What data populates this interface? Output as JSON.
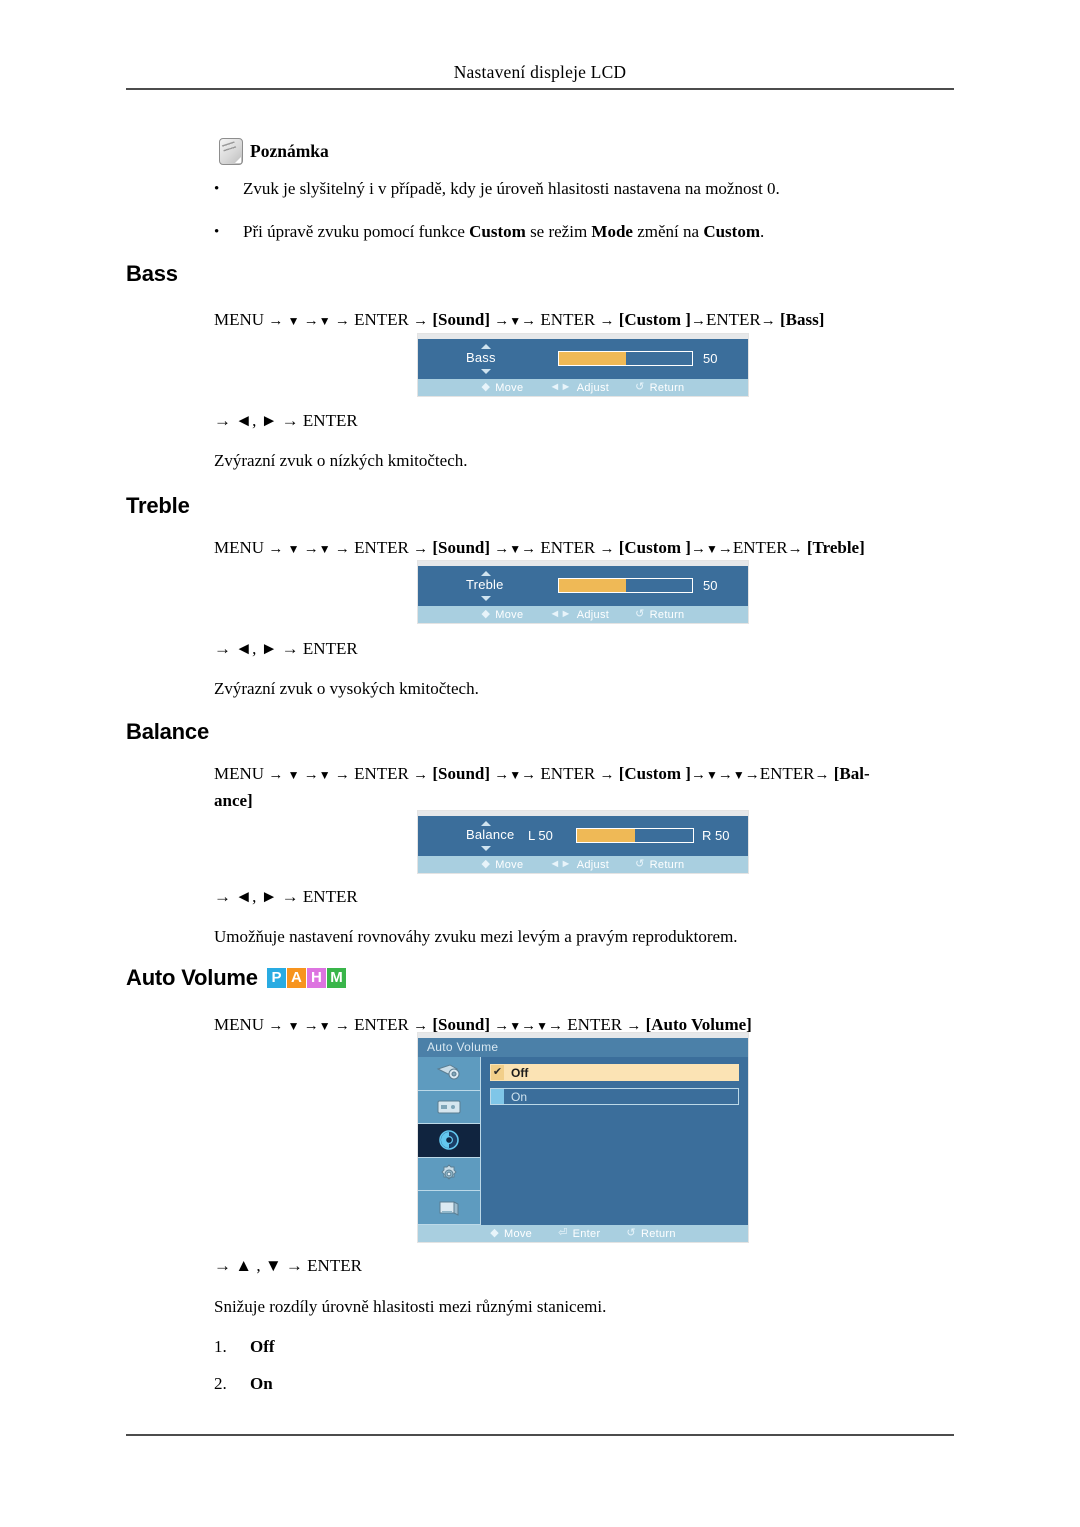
{
  "header": {
    "title": "Nastavení displeje LCD"
  },
  "note": {
    "icon": "note-pen-icon",
    "label": "Poznámka",
    "bullet_marker": "•",
    "items": [
      {
        "prefix": "Zvuk je slyšitelný i v případě, kdy je úroveň hlasitosti nastavena na možnost 0.",
        "bold1": "",
        "mid": "",
        "bold2": "",
        "mid2": "",
        "bold3": "",
        "suffix": ""
      },
      {
        "prefix": "Při úpravě zvuku pomocí funkce ",
        "bold1": "Custom",
        "mid": " se režim ",
        "bold2": "Mode",
        "mid2": " změní na ",
        "bold3": "Custom",
        "suffix": "."
      }
    ]
  },
  "sections": {
    "bass": {
      "heading": "Bass",
      "path": {
        "menu": "MENU",
        "a1": "→",
        "d1": "▼",
        "a2": "→",
        "d2": "▼",
        "a3": "→",
        "enter1": "ENTER",
        "a4": "→",
        "sound": "[Sound]",
        "a5": "→",
        "d3": "▼",
        "a6": "→",
        "enter2": "ENTER",
        "a7": "→",
        "custom": "[Custom ]",
        "a8": "→",
        "enter3": "ENTER",
        "a9": "→",
        "target": "[Bass]"
      },
      "keyline": "→ ◄, ► → ENTER",
      "description": "Zvýrazní zvuk o nízkých kmitočtech.",
      "osd": {
        "label": "Bass",
        "value": "50",
        "fill_percent": 50,
        "footer": [
          {
            "glyph": "◆",
            "text": "Move"
          },
          {
            "glyph": "◄►",
            "text": "Adjust"
          },
          {
            "glyph": "↺",
            "text": "Return"
          }
        ]
      }
    },
    "treble": {
      "heading": "Treble",
      "path": {
        "menu": "MENU",
        "a1": "→",
        "d1": "▼",
        "a2": "→",
        "d2": "▼",
        "a3": "→",
        "enter1": "ENTER",
        "a4": "→",
        "sound": "[Sound]",
        "a5": "→",
        "d3": "▼",
        "a6": "→",
        "enter2": "ENTER",
        "a7": "→",
        "custom": "[Custom ]",
        "a8": "→",
        "d4": "▼",
        "a8b": "→",
        "enter3": "ENTER",
        "a9": "→",
        "target": "[Treble]"
      },
      "keyline": "→ ◄, ► → ENTER",
      "description": "Zvýrazní zvuk o vysokých kmitočtech.",
      "osd": {
        "label": "Treble",
        "value": "50",
        "fill_percent": 50,
        "footer": [
          {
            "glyph": "◆",
            "text": "Move"
          },
          {
            "glyph": "◄►",
            "text": "Adjust"
          },
          {
            "glyph": "↺",
            "text": "Return"
          }
        ]
      }
    },
    "balance": {
      "heading": "Balance",
      "path": {
        "menu": "MENU",
        "a1": "→",
        "d1": "▼",
        "a2": "→",
        "d2": "▼",
        "a3": "→",
        "enter1": "ENTER",
        "a4": "→",
        "sound": "[Sound]",
        "a5": "→",
        "d3": "▼",
        "a6": "→",
        "enter2": "ENTER",
        "a7": "→",
        "custom": "[Custom ]",
        "a8": "→",
        "d4": "▼",
        "a8b": "→",
        "d5": "▼",
        "a8c": "→",
        "enter3": "ENTER",
        "a9": "→",
        "target": "[Bal-",
        "target_wrap": "ance]"
      },
      "keyline": "→ ◄, ► → ENTER",
      "description": "Umožňuje nastavení rovnováhy zvuku mezi levým a pravým reproduktorem.",
      "osd": {
        "label": "Balance",
        "left_label": "L  50",
        "right_label": "R  50",
        "fill_percent": 50,
        "footer": [
          {
            "glyph": "◆",
            "text": "Move"
          },
          {
            "glyph": "◄►",
            "text": "Adjust"
          },
          {
            "glyph": "↺",
            "text": "Return"
          }
        ]
      }
    },
    "auto_volume": {
      "heading": "Auto Volume",
      "badges": [
        {
          "letter": "P",
          "color": "#29abe2"
        },
        {
          "letter": "A",
          "color": "#f7941e"
        },
        {
          "letter": "H",
          "color": "#dd74e0"
        },
        {
          "letter": "M",
          "color": "#39b54a"
        }
      ],
      "path": {
        "menu": "MENU",
        "a1": "→",
        "d1": "▼",
        "a2": "→",
        "d2": "▼",
        "a3": "→",
        "enter1": "ENTER",
        "a4": "→",
        "sound": "[Sound]",
        "a5": "→",
        "d3": "▼",
        "a6": "→",
        "d4": "▼",
        "a6b": "→",
        "enter2": "ENTER",
        "a7": "→",
        "target": "[Auto Volume]"
      },
      "keyline": "→ ▲ , ▼ → ENTER",
      "description": "Snižuje rozdíly úrovně hlasitosti mezi různými stanicemi.",
      "options": [
        {
          "num": "1.",
          "value": "Off"
        },
        {
          "num": "2.",
          "value": "On"
        }
      ],
      "osd": {
        "title": "Auto Volume",
        "icons": [
          "picture-icon",
          "input-source-icon",
          "sound-icon",
          "setup-gear-icon",
          "multi-control-icon"
        ],
        "selected_icon_index": 2,
        "rows": [
          {
            "label": "Off",
            "selected": true,
            "check": "✔"
          },
          {
            "label": "On",
            "selected": false,
            "check": ""
          }
        ],
        "footer": [
          {
            "glyph": "◆",
            "text": "Move"
          },
          {
            "glyph": "⏎",
            "text": "Enter"
          },
          {
            "glyph": "↺",
            "text": "Return"
          }
        ]
      }
    }
  }
}
